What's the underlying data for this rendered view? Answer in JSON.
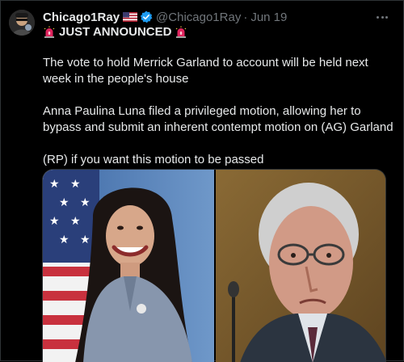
{
  "tweet": {
    "display_name": "Chicago1Ray",
    "handle": "@Chicago1Ray",
    "separator": "·",
    "date": "Jun 19",
    "headline": "JUST ANNOUNCED",
    "paragraphs": [
      "The vote to hold Merrick Garland to account will be held next week in the people's house",
      "Anna Paulina Luna filed a privileged motion, allowing her to bypass and submit an inherent contempt motion on (AG) Garland",
      "(RP) if you want this motion to be passed"
    ],
    "icons": {
      "flag": "us-flag-icon",
      "verified": "verified-badge-icon",
      "siren": "police-siren-icon",
      "more": "more-options-icon"
    },
    "media": {
      "left": "photo-woman-with-american-flag",
      "right": "photo-man-with-glasses"
    }
  },
  "colors": {
    "background": "#000000",
    "text": "#e7e9ea",
    "muted": "#71767b",
    "verified": "#1d9bf0",
    "siren": "#e0245e"
  }
}
